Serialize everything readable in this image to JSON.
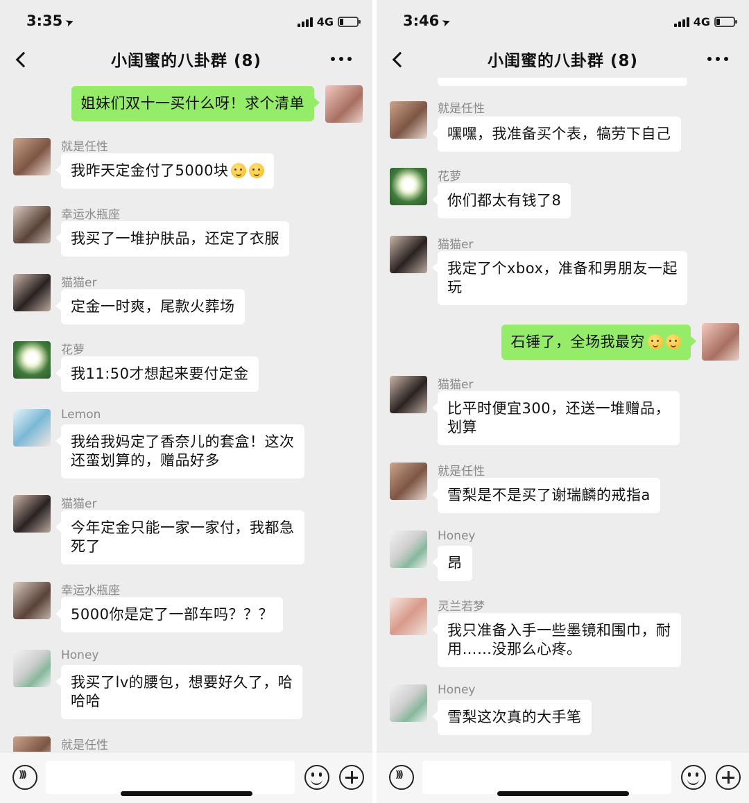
{
  "left": {
    "status": {
      "time": "3:35",
      "network": "4G"
    },
    "title": "小闺蜜的八卦群 (8)",
    "messages": [
      {
        "sender": "",
        "text": "姐妹们双十一买什么呀！求个清单"
      },
      {
        "sender": "就是任性",
        "text": "我昨天定金付了5000块"
      },
      {
        "sender": "幸运水瓶座",
        "text": "我买了一堆护肤品，还定了衣服"
      },
      {
        "sender": "猫猫er",
        "text": "定金一时爽，尾款火葬场"
      },
      {
        "sender": "花萝",
        "text": "我11:50才想起来要付定金"
      },
      {
        "sender": "Lemon",
        "line1": "我给我妈定了香奈儿的套盒！这次",
        "line2": "还蛮划算的，赠品好多"
      },
      {
        "sender": "猫猫er",
        "line1": "今年定金只能一家一家付，我都急",
        "line2": "死了"
      },
      {
        "sender": "幸运水瓶座",
        "text": "5000你是定了一部车吗？？？"
      },
      {
        "sender": "Honey",
        "line1": "我买了lv的腰包，想要好久了，哈",
        "line2": "哈哈"
      },
      {
        "sender": "就是任性",
        "text": ""
      }
    ]
  },
  "right": {
    "status": {
      "time": "3:46",
      "network": "4G"
    },
    "title": "小闺蜜的八卦群 (8)",
    "messages": [
      {
        "sender": "就是任性",
        "text": "嘿嘿，我准备买个表，犒劳下自己"
      },
      {
        "sender": "花萝",
        "text": "你们都太有钱了8"
      },
      {
        "sender": "猫猫er",
        "line1": "我定了个xbox，准备和男朋友一起",
        "line2": "玩"
      },
      {
        "sender": "",
        "text": "石锤了，全场我最穷"
      },
      {
        "sender": "猫猫er",
        "line1": "比平时便宜300，还送一堆赠品，",
        "line2": "划算"
      },
      {
        "sender": "就是任性",
        "text": "雪梨是不是买了谢瑞麟的戒指a"
      },
      {
        "sender": "Honey",
        "text": "昂"
      },
      {
        "sender": "灵兰若梦",
        "line1": "我只准备入手一些墨镜和围巾，耐",
        "line2": "用……没那么心疼。"
      },
      {
        "sender": "Honey",
        "text": "雪梨这次真的大手笔"
      }
    ]
  },
  "icons": {
    "back": "chevron-left-icon",
    "more": "more-dots-icon",
    "voice": "voice-icon",
    "emoji": "emoji-face-icon",
    "plus": "plus-icon"
  },
  "colors": {
    "background": "#ededed",
    "bubble_in": "#ffffff",
    "bubble_out": "#95ec69",
    "sender_name": "#8a8a8a"
  }
}
